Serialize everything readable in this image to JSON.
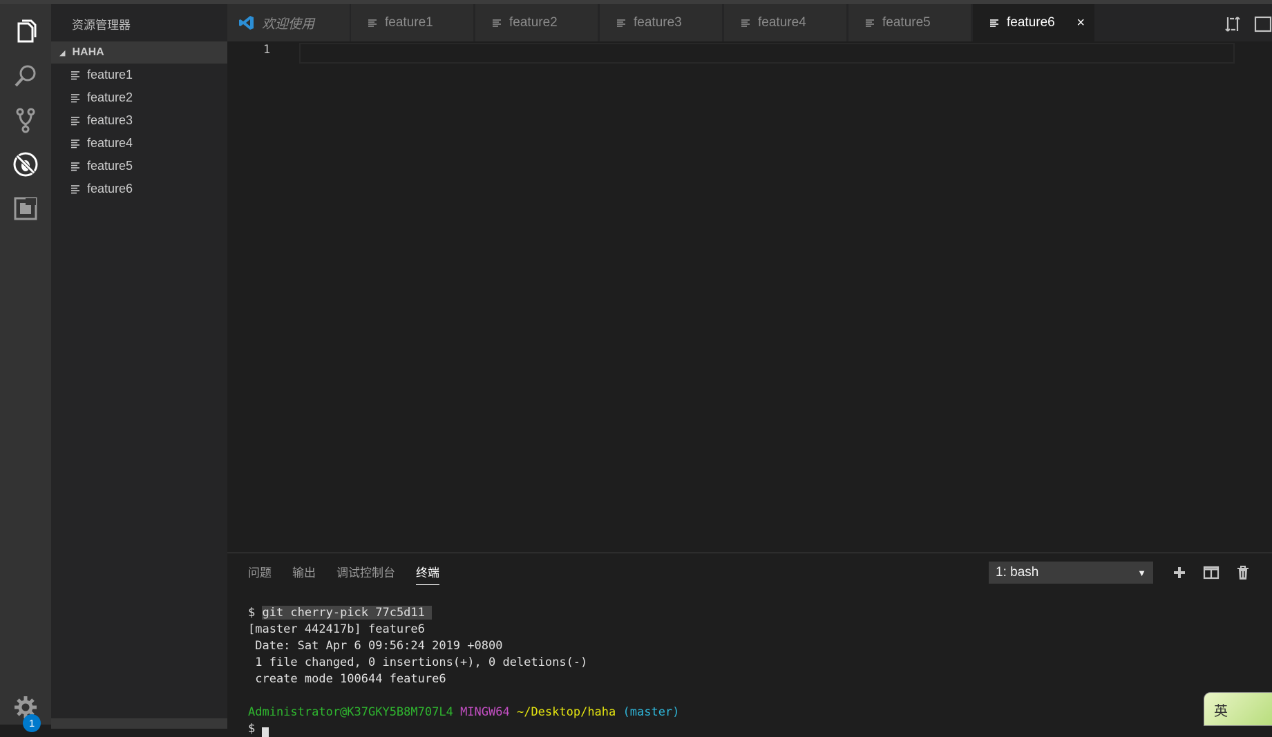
{
  "activity_bar": {
    "items": [
      "explorer",
      "search",
      "source-control",
      "debug",
      "extensions"
    ],
    "gear_badge": "1"
  },
  "sidebar": {
    "title": "资源管理器",
    "section": "HAHA",
    "files": [
      "feature1",
      "feature2",
      "feature3",
      "feature4",
      "feature5",
      "feature6"
    ]
  },
  "tabs": [
    {
      "label": "欢迎使用",
      "icon": "vscode-icon"
    },
    {
      "label": "feature1",
      "icon": "file-lines-icon"
    },
    {
      "label": "feature2",
      "icon": "file-lines-icon"
    },
    {
      "label": "feature3",
      "icon": "file-lines-icon"
    },
    {
      "label": "feature4",
      "icon": "file-lines-icon"
    },
    {
      "label": "feature5",
      "icon": "file-lines-icon"
    },
    {
      "label": "feature6",
      "icon": "file-lines-icon",
      "active": true
    }
  ],
  "tab_close": "×",
  "editor": {
    "line_number": "1"
  },
  "panel": {
    "tabs": [
      "问题",
      "输出",
      "调试控制台",
      "终端"
    ],
    "active_tab": "终端",
    "terminal_select": "1: bash",
    "select_arrow": "▼"
  },
  "terminal": {
    "prompt": "$ ",
    "command": "git cherry-pick 77c5d11 ",
    "lines": [
      "[master 442417b] feature6",
      " Date: Sat Apr 6 09:56:24 2019 +0800",
      " 1 file changed, 0 insertions(+), 0 deletions(-)",
      " create mode 100644 feature6"
    ],
    "user_host": "Administrator@K37GKY5B8M707L4",
    "shell": "MINGW64",
    "path": "~/Desktop/haha",
    "branch": "(master)",
    "last_prompt": "$ "
  },
  "ime": {
    "label": "英"
  },
  "colors": {
    "accent": "#007acc",
    "terminal_green": "#2fb62f",
    "terminal_magenta": "#c44fc4",
    "terminal_yellow": "#e5e510",
    "terminal_cyan": "#2fb6d9"
  }
}
